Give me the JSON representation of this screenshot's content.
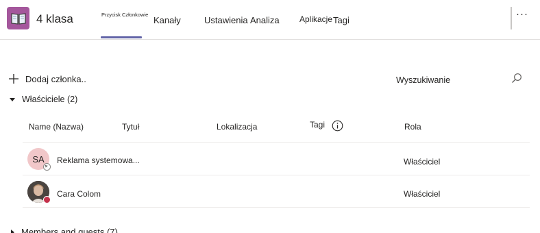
{
  "header": {
    "team_name": "4 klasa",
    "active_tab_label": "Przycisk Członkowie",
    "tabs": [
      "Kanały",
      "Ustawienia",
      "Analiza",
      "Aplikacje",
      "Tagi"
    ],
    "more_label": "···"
  },
  "toolbar": {
    "add_member_label": "Dodaj członka",
    "add_member_suffix": "..",
    "search_label": "Wyszukiwanie"
  },
  "owners_section": {
    "title": "Właściciele (2)",
    "columns": [
      "Name (Nazwa)",
      "Tytuł",
      "Lokalizacja",
      "Tagi",
      "Rola"
    ],
    "rows": [
      {
        "initials": "SA",
        "name": "Reklama systemowa...",
        "role": "Właściciel",
        "status": "offline"
      },
      {
        "initials": "",
        "name": "Cara Colom",
        "role": "Właściciel",
        "status": "busy"
      }
    ]
  },
  "members_section": {
    "title": "Members and guests (7)"
  },
  "colors": {
    "accent": "#6264a7",
    "team_icon": "#a4579c",
    "avatar_sa": "#f1c7c9",
    "busy": "#c4314b"
  }
}
